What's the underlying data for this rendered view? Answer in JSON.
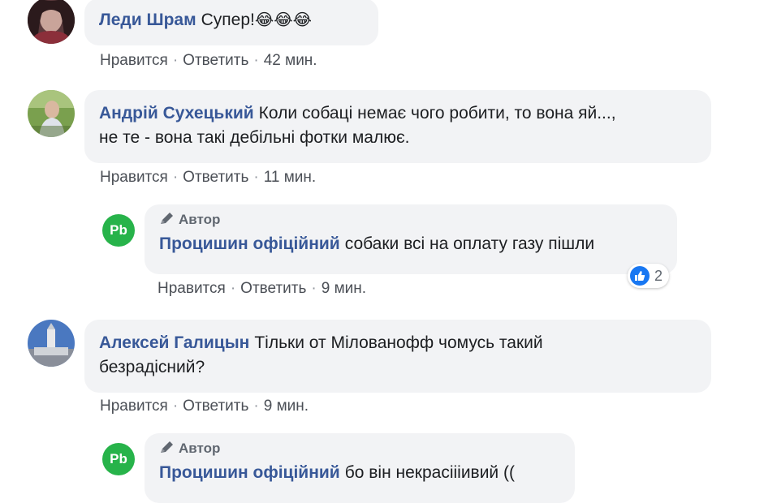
{
  "comments": [
    {
      "author": "Леди Шрам",
      "text": "Супер!",
      "emojis": "😂😂😂",
      "like": "Нравится",
      "reply": "Ответить",
      "time": "42 мин."
    },
    {
      "author": "Андрій Сухецький",
      "text_line1": "Коли собаці немає чого робити, то вона яй...,",
      "text_line2": "не те - вона такі дебільні фотки малює.",
      "like": "Нравится",
      "reply": "Ответить",
      "time": "11 мин."
    },
    {
      "badge": "Автор",
      "author": "Процишин офіційний",
      "avatar_text": "Pb",
      "text": "собаки всі на оплату газу пішли",
      "like": "Нравится",
      "reply": "Ответить",
      "time": "9 мин.",
      "reaction_count": "2"
    },
    {
      "author": "Алексей Галицын",
      "text_line1": "Тільки от Мілованофф чомусь такий",
      "text_line2": "безрадісний?",
      "like": "Нравится",
      "reply": "Ответить",
      "time": "9 мин."
    },
    {
      "badge": "Автор",
      "author": "Процишин офіційний",
      "avatar_text": "Pb",
      "text": "бо він некрасіііивий (("
    }
  ],
  "separator": "·",
  "colors": {
    "name": "#385898",
    "bubble": "#f2f3f5",
    "meta": "#4b4f56",
    "author_avatar": "#27b34a",
    "like_reaction": "#1877f2"
  },
  "icons": [
    "pencil-icon",
    "like-reaction-icon",
    "laughing-emoji"
  ]
}
